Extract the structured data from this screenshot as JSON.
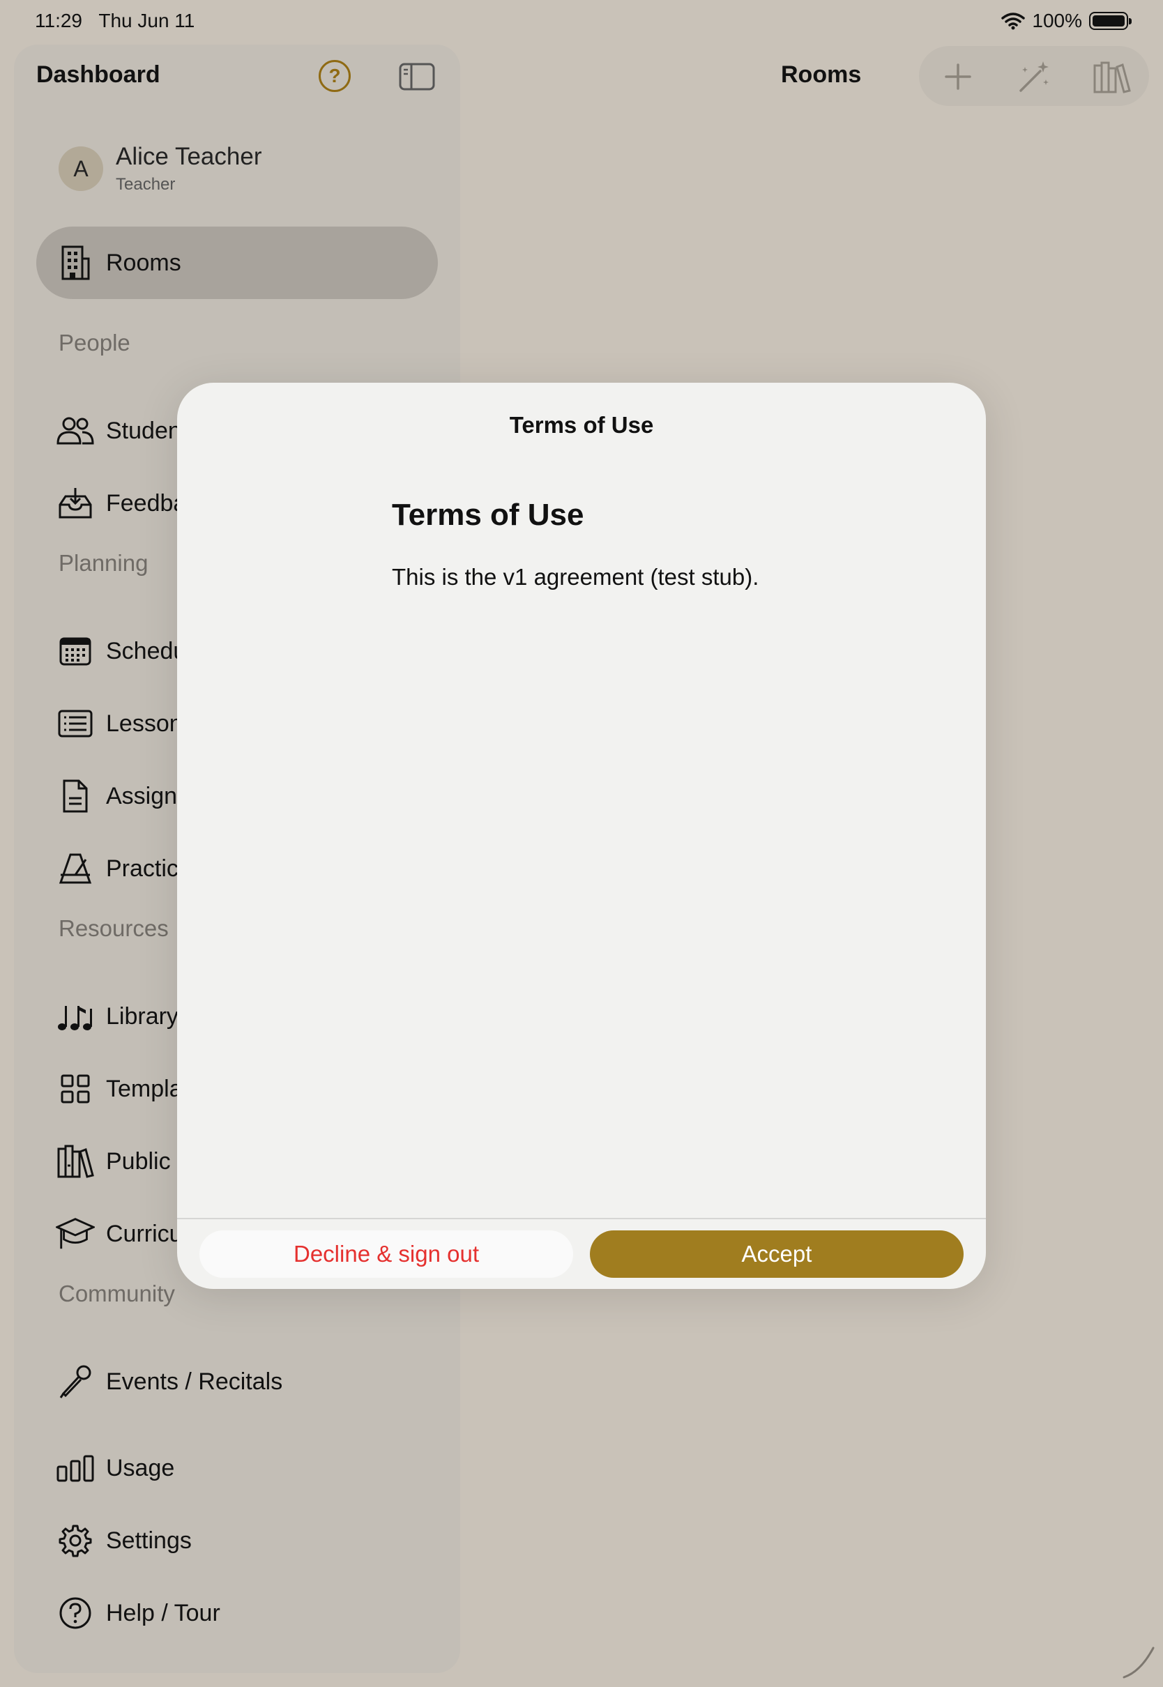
{
  "status_bar": {
    "time": "11:29",
    "date": "Thu Jun 11",
    "battery": "100%",
    "wifi_icon": "wifi-icon",
    "battery_icon": "battery-icon"
  },
  "sidebar": {
    "title": "Dashboard",
    "profile": {
      "initial": "A",
      "name": "Alice Teacher",
      "role": "Teacher"
    },
    "selected_item": "Rooms",
    "items": [
      {
        "label": "Rooms",
        "icon": "building-icon"
      },
      {
        "label": "Students",
        "icon": "people-icon"
      },
      {
        "label": "Feedback",
        "icon": "tray-download-icon"
      },
      {
        "label": "Schedule",
        "icon": "calendar-icon"
      },
      {
        "label": "Lessons",
        "icon": "list-icon"
      },
      {
        "label": "Assignments",
        "icon": "document-icon"
      },
      {
        "label": "Practice",
        "icon": "metronome-icon"
      },
      {
        "label": "Library",
        "icon": "music-notes-icon"
      },
      {
        "label": "Templates",
        "icon": "grid-icon"
      },
      {
        "label": "Public",
        "icon": "books-icon"
      },
      {
        "label": "Curriculum",
        "icon": "graduation-cap-icon"
      },
      {
        "label": "Events / Recitals",
        "icon": "microphone-icon"
      },
      {
        "label": "Usage",
        "icon": "bar-chart-icon"
      },
      {
        "label": "Settings",
        "icon": "gear-icon"
      },
      {
        "label": "Help / Tour",
        "icon": "question-circle-icon"
      }
    ],
    "sections": [
      "People",
      "Planning",
      "Resources",
      "Community"
    ]
  },
  "detail": {
    "title": "Rooms"
  },
  "modal": {
    "title": "Terms of Use",
    "heading": "Terms of Use",
    "body": "This is the v1 agreement (test stub).",
    "decline_label": "Decline & sign out",
    "accept_label": "Accept"
  },
  "colors": {
    "accent": "#a07d1f",
    "danger": "#e5312f",
    "background": "#c9c2b8"
  }
}
